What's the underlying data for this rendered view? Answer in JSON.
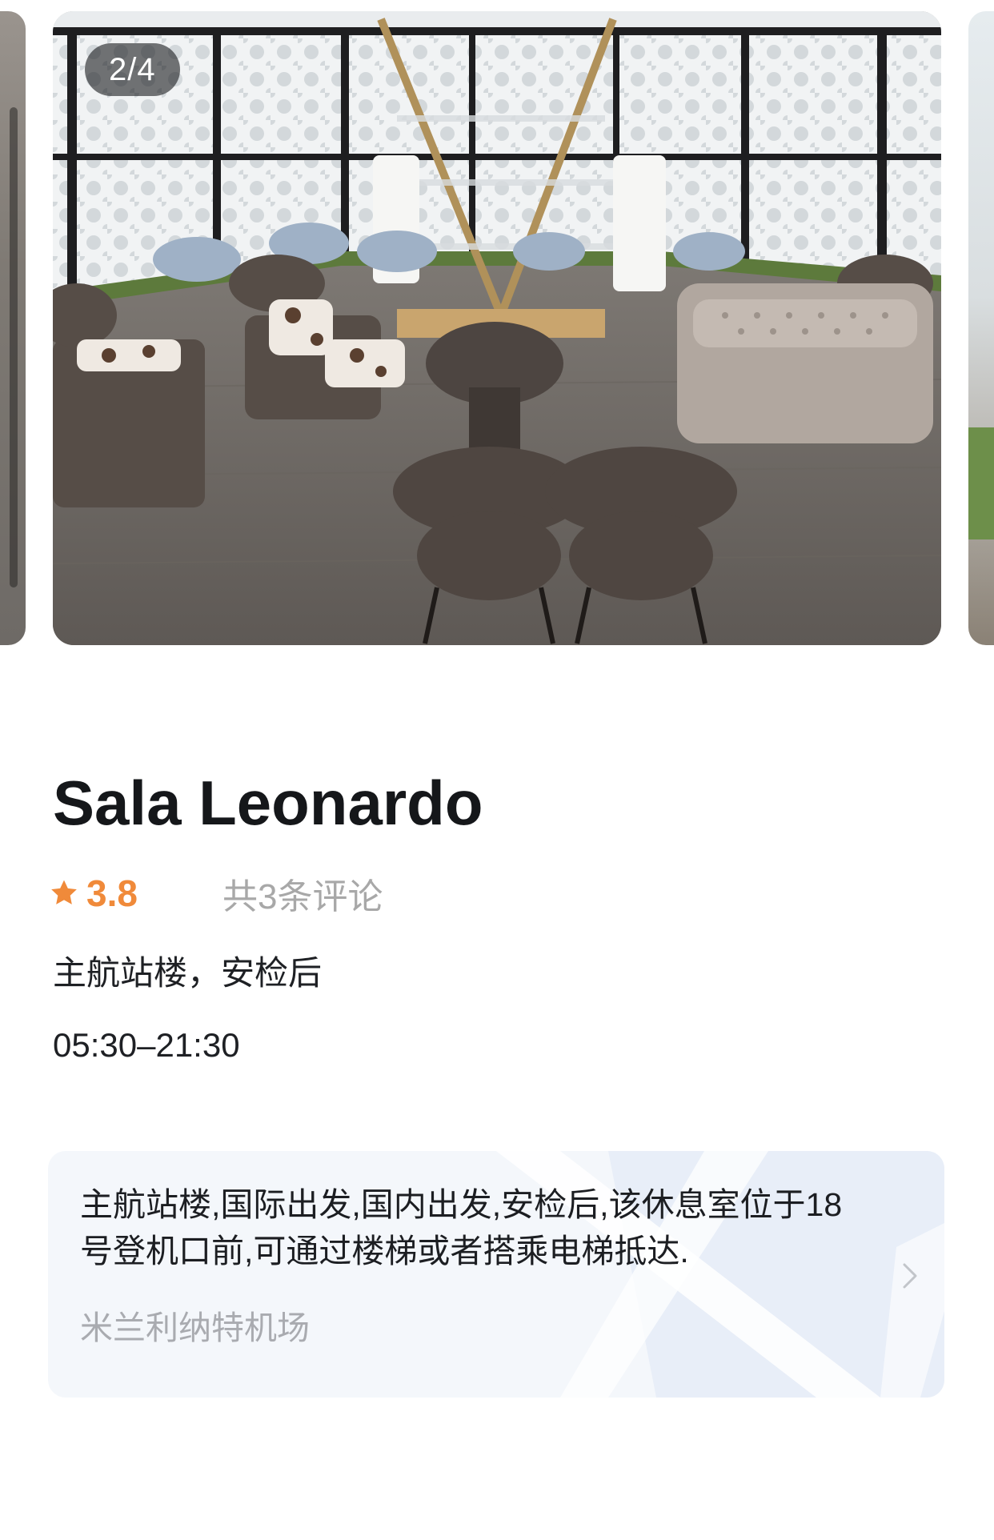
{
  "carousel": {
    "current_page": 2,
    "total_pages": 4,
    "indicator": "2/4"
  },
  "lounge": {
    "name": "Sala Leonardo",
    "rating": "3.8",
    "review_count": "共3条评论",
    "location": "主航站楼，安检后",
    "hours": "05:30–21:30"
  },
  "description": {
    "text": "主航站楼,国际出发,国内出发,安检后,该休息室位于18号登机口前,可通过楼梯或者搭乘电梯抵达.",
    "airport": "米兰利纳特机场"
  },
  "icons": {
    "rating": "star-icon",
    "open_detail": "chevron-right-icon"
  },
  "colors": {
    "rating_accent": "#f08a3a",
    "secondary_text": "#a8a8a8",
    "card_background": "#f4f7fb"
  }
}
